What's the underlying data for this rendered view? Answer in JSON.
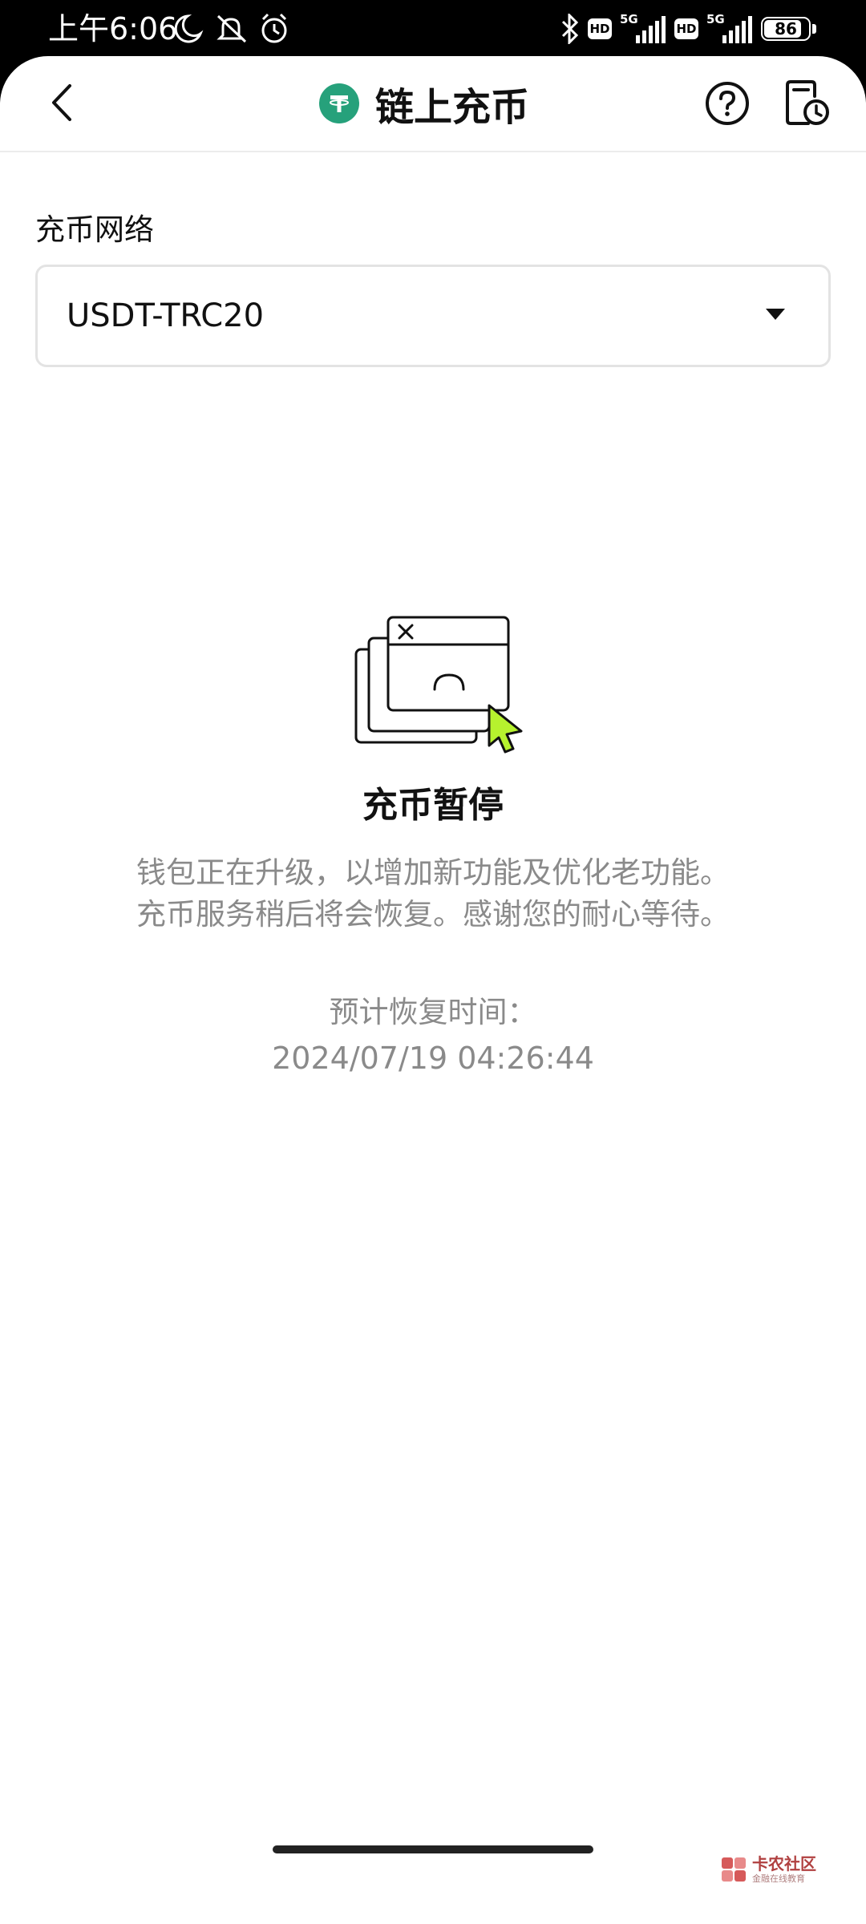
{
  "status_bar": {
    "time": "上午6:06",
    "network_type_1": "5G",
    "network_type_2": "5G",
    "hd_label": "HD",
    "battery_level": "86",
    "battery_fraction": 0.86,
    "icons": [
      "moon-icon",
      "mute-icon",
      "alarm-icon",
      "bluetooth-icon",
      "hd-icon",
      "signal-icon",
      "battery-icon"
    ]
  },
  "header": {
    "title": "链上充币",
    "coin_icon": "tether-icon",
    "coin_color": "#26a17b",
    "back_icon": "chevron-left-icon",
    "help_icon": "question-circle-icon",
    "history_icon": "history-clock-icon"
  },
  "network": {
    "label": "充币网络",
    "selected": "USDT-TRC20"
  },
  "paused": {
    "illustration": "paused-windows-cursor-illustration",
    "accent": "#b6f22e",
    "title": "充币暂停",
    "message_line1": "钱包正在升级，以增加新功能及优化老功能。",
    "message_line2": "充币服务稍后将会恢复。感谢您的耐心等待。",
    "eta_label": "预计恢复时间：",
    "eta_value": "2024/07/19 04:26:44"
  },
  "watermark": {
    "name": "卡农社区",
    "slogan": "金融在线教育"
  }
}
